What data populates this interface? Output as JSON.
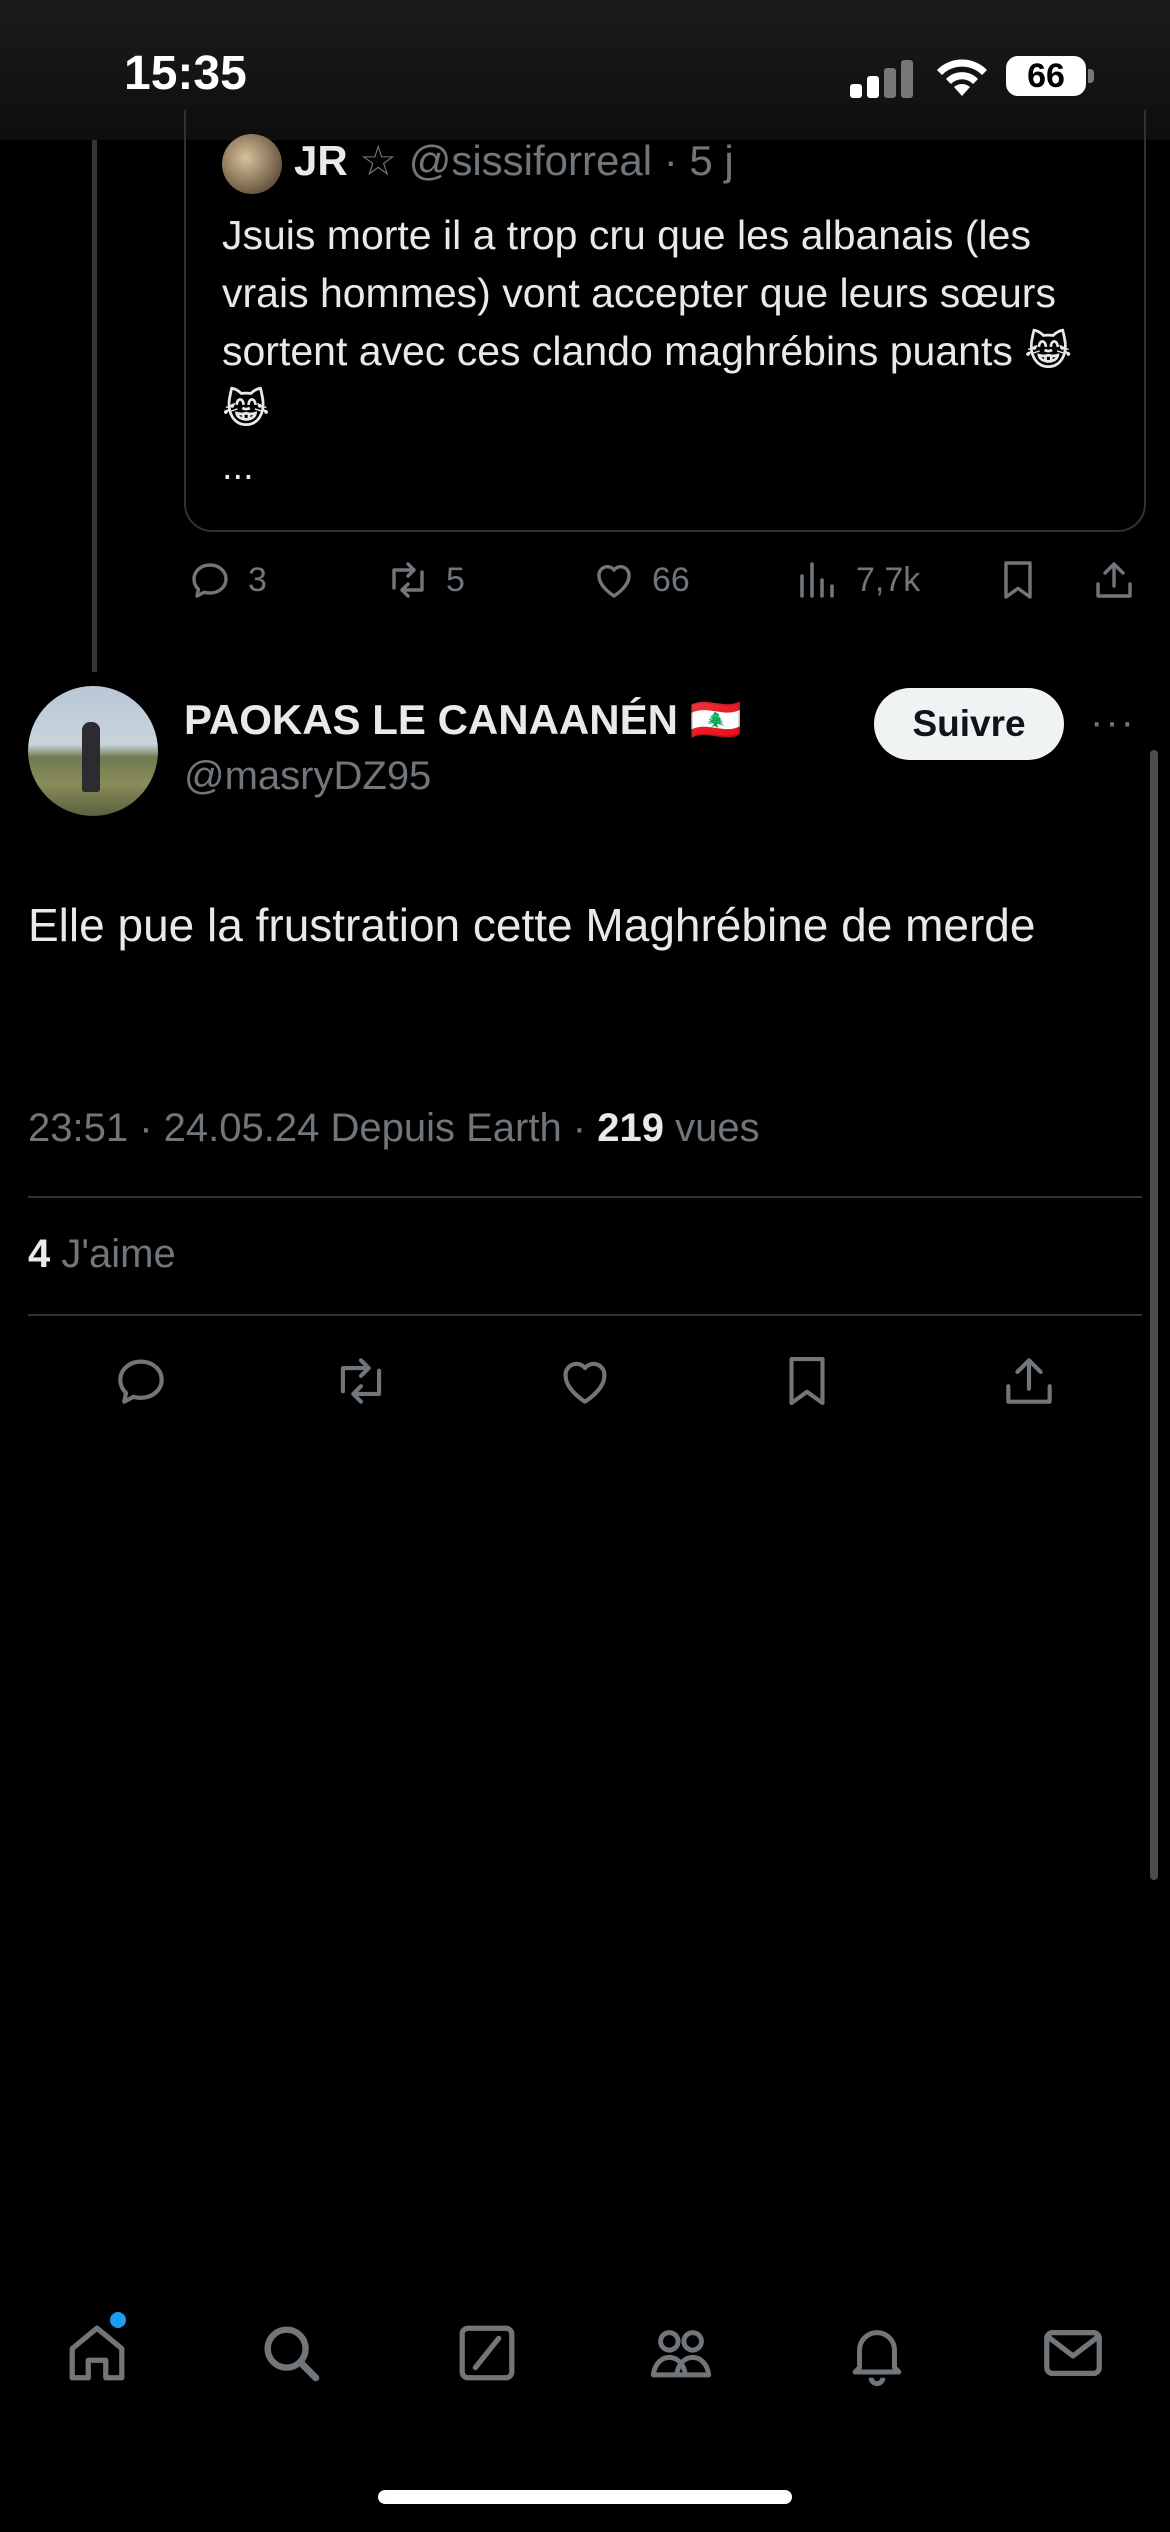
{
  "status_bar": {
    "time": "15:35",
    "battery": "66"
  },
  "quoted_tweet": {
    "name": "JR",
    "star": "☆",
    "handle": "@sissiforreal",
    "age": "· 5 j",
    "text": "Jsuis morte il a trop cru que les albanais (les vrais hommes) vont accepter que leurs sœurs sortent avec ces clando maghrébins puants 😹 😹",
    "ellipsis": "...",
    "actions": {
      "replies": "3",
      "reposts": "5",
      "likes": "66",
      "views": "7,7k"
    }
  },
  "tweet": {
    "display_name": "PAOKAS LE CANAANÉN 🇱🇧",
    "handle": "@masryDZ95",
    "follow_label": "Suivre",
    "more_label": "···",
    "text": "Elle pue la frustration cette Maghrébine de merde",
    "meta_time": "23:51 · 24.05.24 Depuis Earth · ",
    "views_count": "219",
    "views_label": " vues",
    "likes_count": "4",
    "likes_label": " J'aime"
  },
  "nav": {
    "items": [
      "home-icon",
      "search-icon",
      "compose-icon",
      "communities-icon",
      "notifications-icon",
      "messages-icon"
    ]
  },
  "colors": {
    "background": "#000000",
    "accent": "#1d9bf0",
    "muted": "#71767b"
  }
}
